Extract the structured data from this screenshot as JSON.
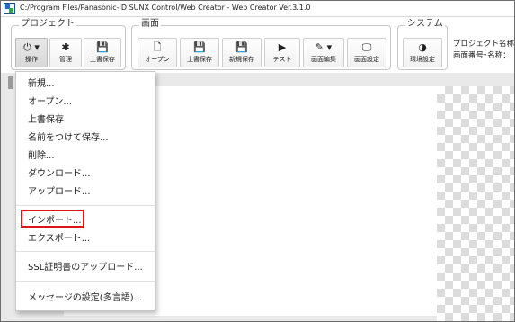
{
  "window": {
    "title": "C:/Program Files/Panasonic-ID SUNX Control/Web Creator - Web Creator Ver.3.1.0"
  },
  "ribbon": {
    "project_group": {
      "label": "プロジェクト",
      "buttons": [
        {
          "label": "操作",
          "icon": "power-icon",
          "glyph": "⏻ ▾"
        },
        {
          "label": "管理",
          "icon": "gear-icon",
          "glyph": "✱"
        },
        {
          "label": "上書保存",
          "icon": "save-icon",
          "glyph": "💾"
        }
      ]
    },
    "screen_group": {
      "label": "画面",
      "buttons": [
        {
          "label": "オープン",
          "icon": "document-icon",
          "glyph": "🗋"
        },
        {
          "label": "上書保存",
          "icon": "save-icon",
          "glyph": "💾"
        },
        {
          "label": "新規保存",
          "icon": "save-new-icon",
          "glyph": "💾"
        },
        {
          "label": "テスト",
          "icon": "play-icon",
          "glyph": "▶"
        },
        {
          "label": "画面編集",
          "icon": "edit-icon",
          "glyph": "✎ ▾"
        },
        {
          "label": "画面設定",
          "icon": "monitor-icon",
          "glyph": "🖵"
        }
      ]
    },
    "system_group": {
      "label": "システム",
      "buttons": [
        {
          "label": "環境設定",
          "icon": "contrast-icon",
          "glyph": "◑"
        }
      ]
    },
    "info": {
      "project_name_label": "プロジェクト名称:",
      "screen_label": "画面番号･名称："
    }
  },
  "menu": {
    "items": [
      "新規...",
      "オープン...",
      "上書保存",
      "名前をつけて保存...",
      "削除...",
      "ダウンロード...",
      "アップロード...",
      "インポート...",
      "エクスポート...",
      "SSL証明書のアップロード...",
      "メッセージの設定(多言語)..."
    ]
  },
  "colors": {
    "highlight": "#e01515"
  }
}
